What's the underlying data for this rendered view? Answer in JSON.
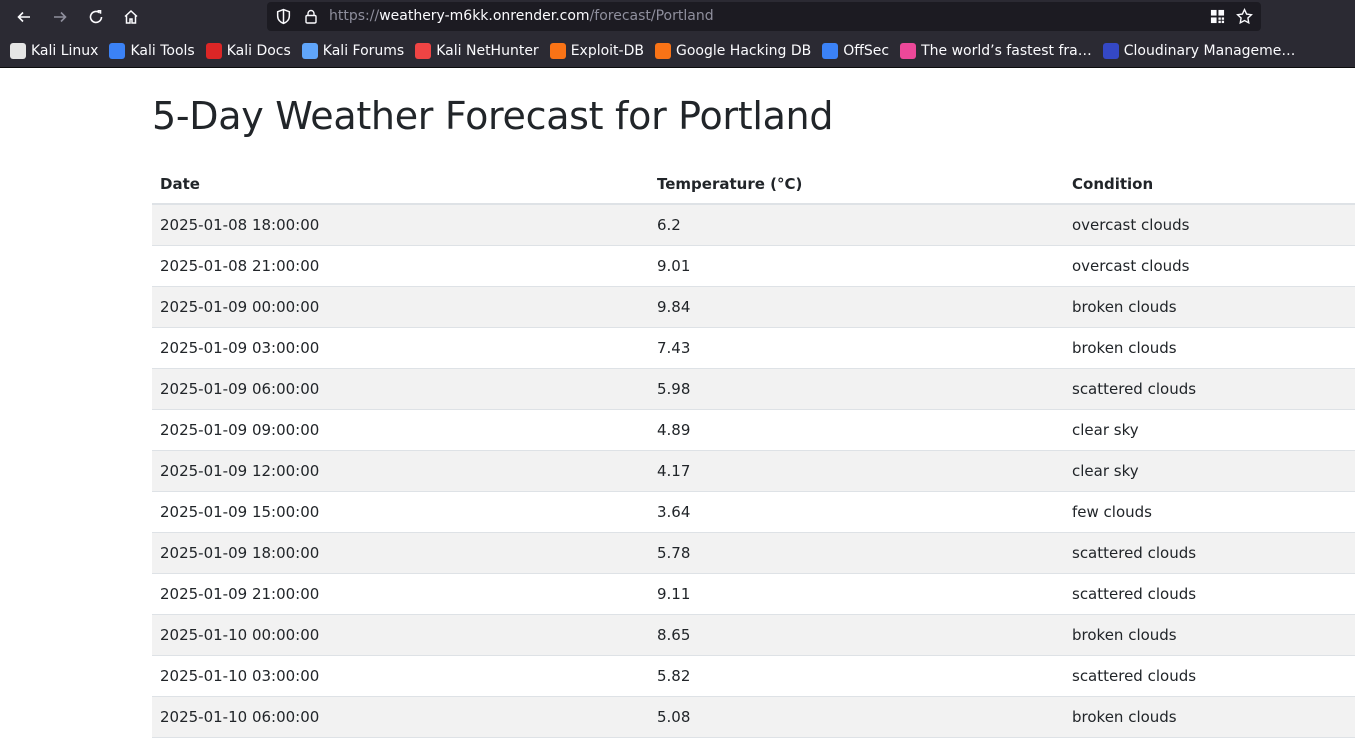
{
  "browser": {
    "url_scheme": "https://",
    "url_host": "weathery-m6kk.onrender.com",
    "url_path": "/forecast/Portland",
    "bookmarks": [
      {
        "label": "Kali Linux",
        "icon": "kali-dragon-icon",
        "color": "#e5e5e5"
      },
      {
        "label": "Kali Tools",
        "icon": "kali-tools-icon",
        "color": "#3b82f6"
      },
      {
        "label": "Kali Docs",
        "icon": "kali-docs-icon",
        "color": "#dc2626"
      },
      {
        "label": "Kali Forums",
        "icon": "kali-forums-icon",
        "color": "#60a5fa"
      },
      {
        "label": "Kali NetHunter",
        "icon": "nethunter-icon",
        "color": "#ef4444"
      },
      {
        "label": "Exploit-DB",
        "icon": "exploit-db-icon",
        "color": "#f97316"
      },
      {
        "label": "Google Hacking DB",
        "icon": "ghdb-icon",
        "color": "#f97316"
      },
      {
        "label": "OffSec",
        "icon": "offsec-icon",
        "color": "#3b82f6"
      },
      {
        "label": "The world’s fastest fra…",
        "icon": "hono-icon",
        "color": "#ec4899"
      },
      {
        "label": "Cloudinary Manageme…",
        "icon": "cloudinary-icon",
        "color": "#3448c5"
      }
    ]
  },
  "page": {
    "title": "5-Day Weather Forecast for Portland",
    "table": {
      "headers": [
        "Date",
        "Temperature (°C)",
        "Condition"
      ],
      "rows": [
        [
          "2025-01-08 18:00:00",
          "6.2",
          "overcast clouds"
        ],
        [
          "2025-01-08 21:00:00",
          "9.01",
          "overcast clouds"
        ],
        [
          "2025-01-09 00:00:00",
          "9.84",
          "broken clouds"
        ],
        [
          "2025-01-09 03:00:00",
          "7.43",
          "broken clouds"
        ],
        [
          "2025-01-09 06:00:00",
          "5.98",
          "scattered clouds"
        ],
        [
          "2025-01-09 09:00:00",
          "4.89",
          "clear sky"
        ],
        [
          "2025-01-09 12:00:00",
          "4.17",
          "clear sky"
        ],
        [
          "2025-01-09 15:00:00",
          "3.64",
          "few clouds"
        ],
        [
          "2025-01-09 18:00:00",
          "5.78",
          "scattered clouds"
        ],
        [
          "2025-01-09 21:00:00",
          "9.11",
          "scattered clouds"
        ],
        [
          "2025-01-10 00:00:00",
          "8.65",
          "broken clouds"
        ],
        [
          "2025-01-10 03:00:00",
          "5.82",
          "scattered clouds"
        ],
        [
          "2025-01-10 06:00:00",
          "5.08",
          "broken clouds"
        ]
      ]
    }
  }
}
